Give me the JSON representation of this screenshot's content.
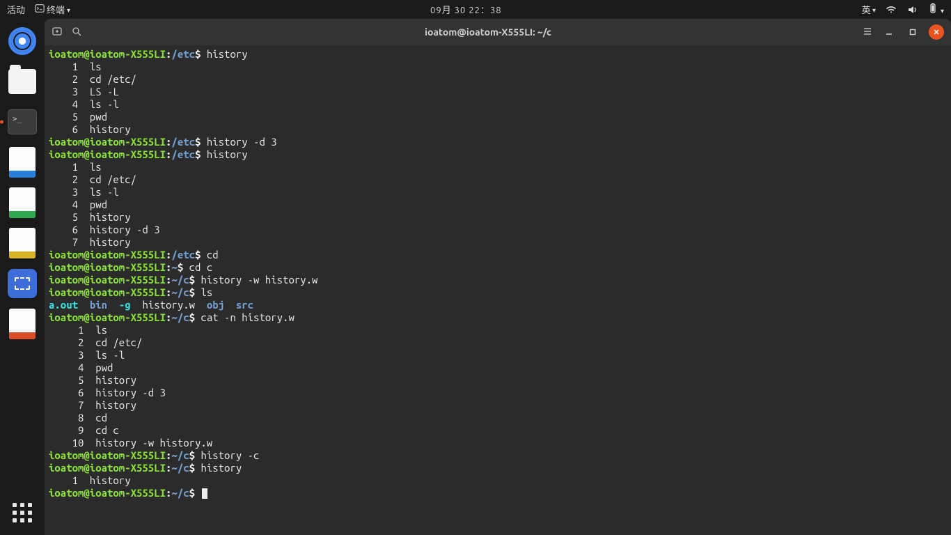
{
  "topbar": {
    "activities": "活动",
    "app_label": "终端",
    "clock": "09月 30 22：38",
    "ime": "英"
  },
  "titlebar": {
    "title": "ioatom@ioatom-X555LI: ~/c"
  },
  "prompt": {
    "user_host": "ioatom@ioatom-X555LI",
    "path_etc": "/etc",
    "path_home": "~",
    "path_c": "~/c",
    "sep": ":",
    "dollar": "$"
  },
  "session": {
    "cmd_history": "history",
    "cmd_history_d3": "history -d 3",
    "cmd_cd": "cd",
    "cmd_cd_c": "cd c",
    "cmd_history_w": "history -w history.w",
    "cmd_ls": "ls",
    "cmd_cat": "cat -n history.w",
    "cmd_history_c": "history -c",
    "hist1": [
      {
        "n": "1",
        "t": "ls"
      },
      {
        "n": "2",
        "t": "cd /etc/"
      },
      {
        "n": "3",
        "t": "LS -L"
      },
      {
        "n": "4",
        "t": "ls -l"
      },
      {
        "n": "5",
        "t": "pwd"
      },
      {
        "n": "6",
        "t": "history"
      }
    ],
    "hist2": [
      {
        "n": "1",
        "t": "ls"
      },
      {
        "n": "2",
        "t": "cd /etc/"
      },
      {
        "n": "3",
        "t": "ls -l"
      },
      {
        "n": "4",
        "t": "pwd"
      },
      {
        "n": "5",
        "t": "history"
      },
      {
        "n": "6",
        "t": "history -d 3"
      },
      {
        "n": "7",
        "t": "history"
      }
    ],
    "ls_out": {
      "aout": "a.out",
      "bin": "bin",
      "g": "-g",
      "hw": "history.w",
      "obj": "obj",
      "src": "src"
    },
    "cat_out": [
      {
        "n": "1",
        "t": "ls"
      },
      {
        "n": "2",
        "t": "cd /etc/"
      },
      {
        "n": "3",
        "t": "ls -l"
      },
      {
        "n": "4",
        "t": "pwd"
      },
      {
        "n": "5",
        "t": "history"
      },
      {
        "n": "6",
        "t": "history -d 3"
      },
      {
        "n": "7",
        "t": "history"
      },
      {
        "n": "8",
        "t": "cd"
      },
      {
        "n": "9",
        "t": "cd c"
      },
      {
        "n": "10",
        "t": "history -w history.w"
      }
    ],
    "hist3": [
      {
        "n": "1",
        "t": "history"
      }
    ]
  }
}
